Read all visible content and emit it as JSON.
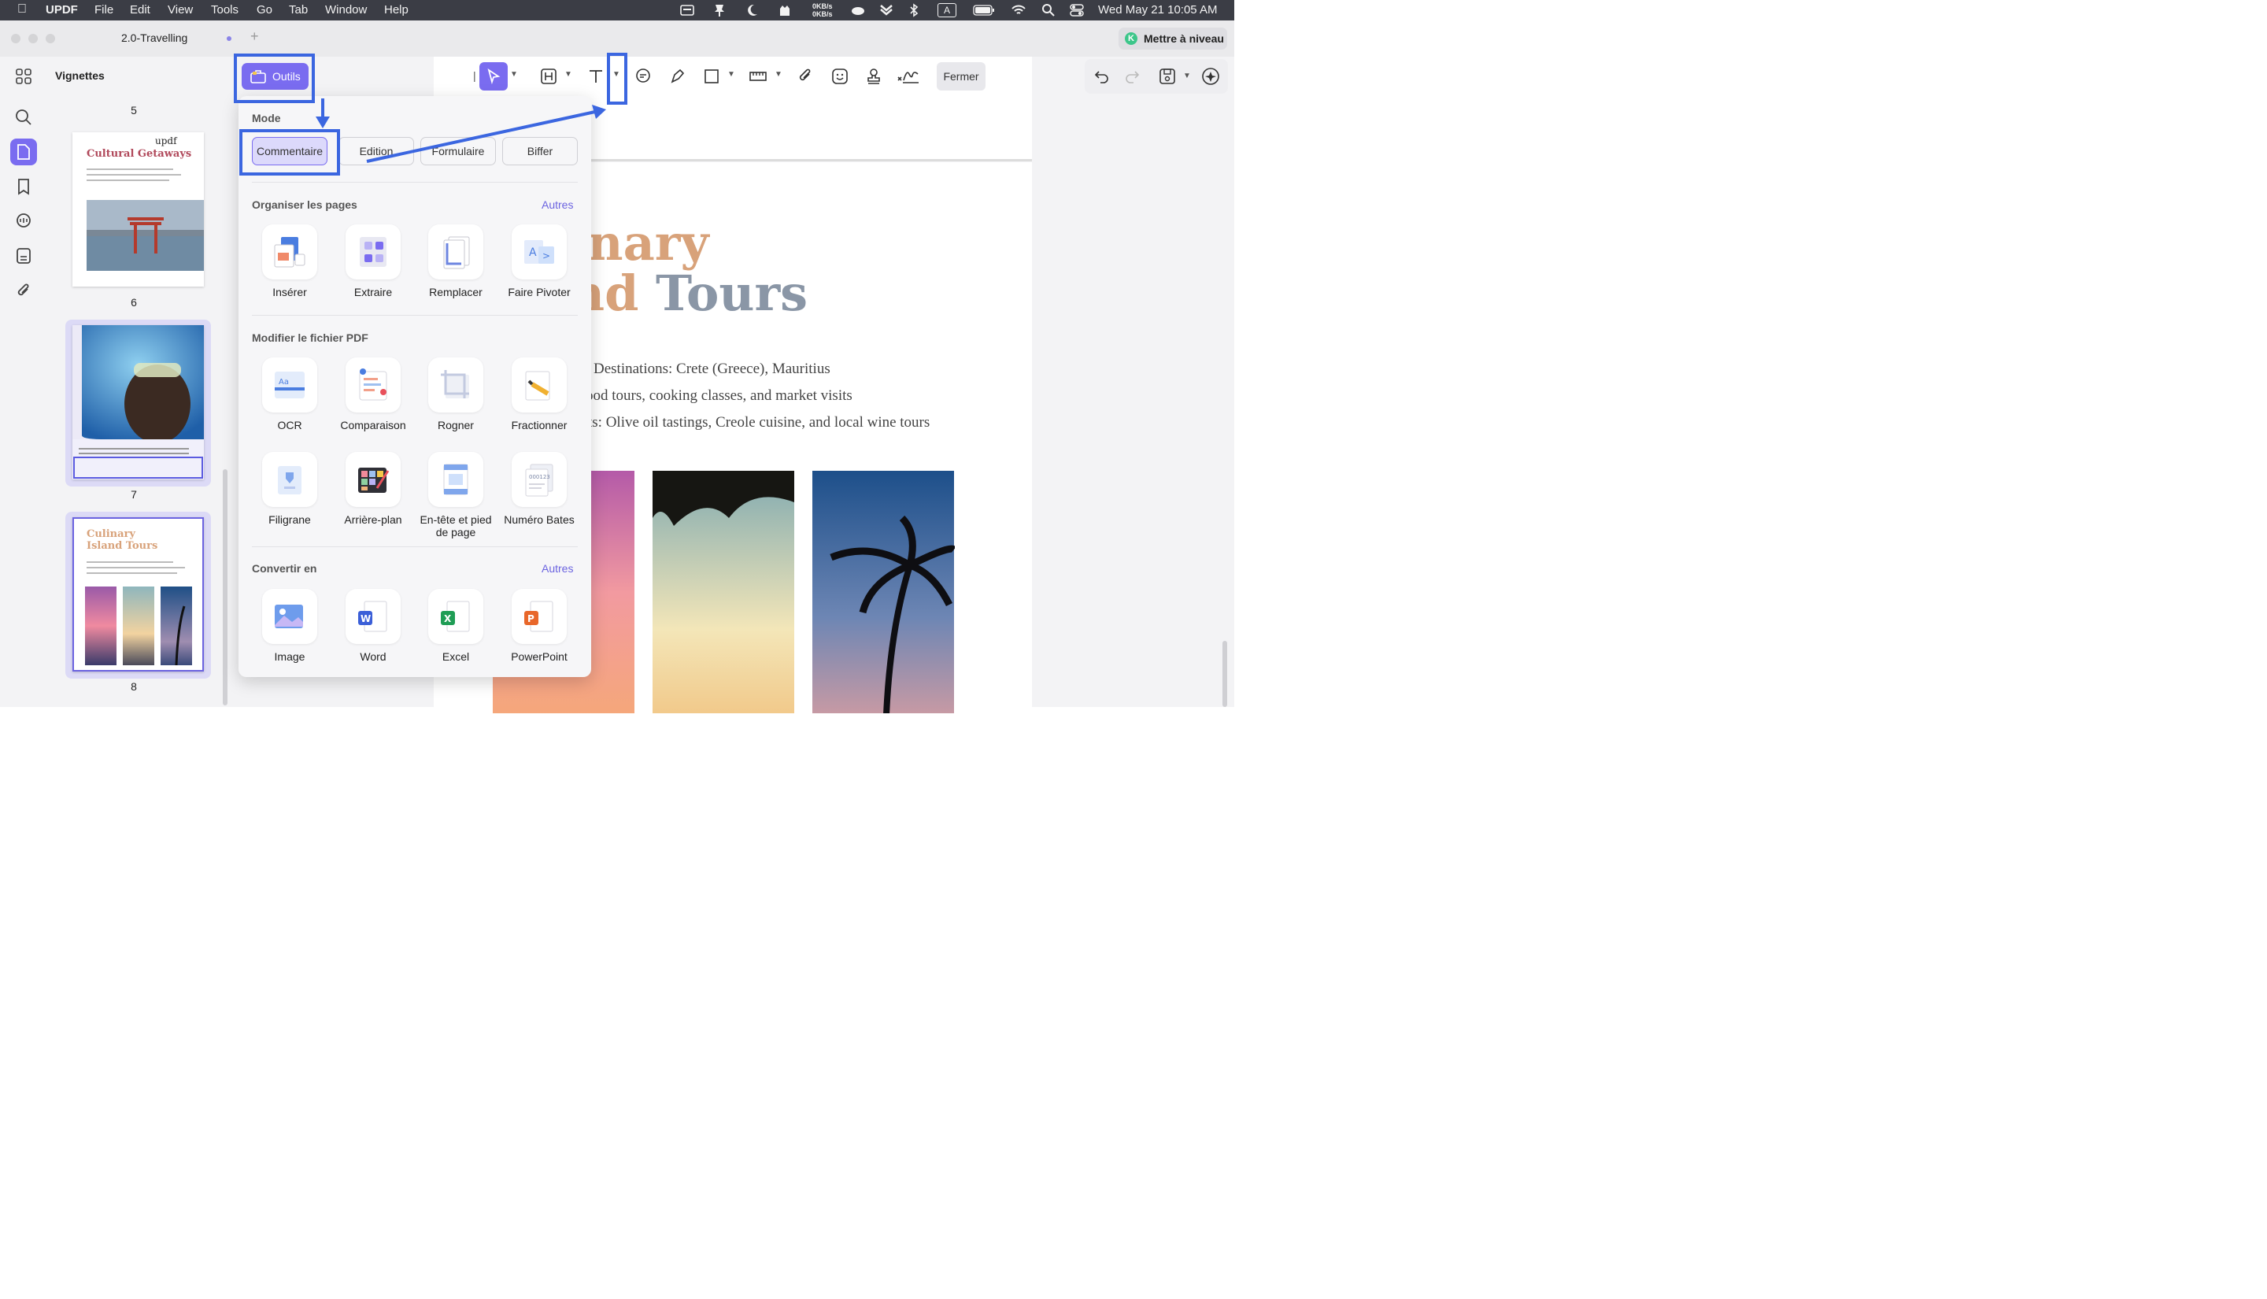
{
  "menubar": {
    "app": "UPDF",
    "items": [
      "File",
      "Edit",
      "View",
      "Tools",
      "Go",
      "Tab",
      "Window",
      "Help"
    ],
    "net_up": "0KB/s",
    "net_down": "0KB/s",
    "input_source": "A",
    "clock": "Wed May 21  10:05 AM"
  },
  "tab": {
    "title": "2.0-Travelling",
    "plus": "+"
  },
  "upgrade": {
    "badge": "K",
    "label": "Mettre à niveau"
  },
  "thumbnails": {
    "title": "Vignettes",
    "pages": [
      {
        "number": "5"
      },
      {
        "number": "6",
        "heading": "Cultural Getaways",
        "stamp": "updf"
      },
      {
        "number": "7"
      },
      {
        "number": "8",
        "heading_1": "Culinary",
        "heading_2": "Island Tours"
      }
    ]
  },
  "outils": {
    "label": "Outils"
  },
  "toolbar": {
    "close_label": "Fermer"
  },
  "panel": {
    "mode": {
      "title": "Mode",
      "buttons": [
        "Commentaire",
        "Edition",
        "Formulaire",
        "Biffer"
      ],
      "active": "Commentaire"
    },
    "organize": {
      "title": "Organiser les pages",
      "more": "Autres",
      "tools": [
        "Insérer",
        "Extraire",
        "Remplacer",
        "Faire Pivoter"
      ]
    },
    "modify": {
      "title": "Modifier le fichier PDF",
      "tools_row1": [
        "OCR",
        "Comparaison",
        "Rogner",
        "Fractionner"
      ],
      "tools_row2": [
        "Filigrane",
        "Arrière-plan",
        "En-tête et pied de page",
        "Numéro Bates"
      ]
    },
    "convert": {
      "title": "Convertir en",
      "more": "Autres",
      "tools": [
        "Image",
        "Word",
        "Excel",
        "PowerPoint"
      ]
    }
  },
  "document": {
    "title_line1": "inary",
    "title_line2_a": "nd ",
    "title_line2_b": "Tours",
    "line1": "Destinations: Crete (Greece), Mauritius",
    "line2": "ood tours, cooking classes, and market visits",
    "line3": "ts: Olive oil tastings, Creole cuisine, and local wine tours"
  },
  "colors": {
    "accent": "#7a6cf0",
    "annotation": "#3b66e0",
    "title_tan": "#d8a27a",
    "title_slate": "#8a96a6"
  }
}
